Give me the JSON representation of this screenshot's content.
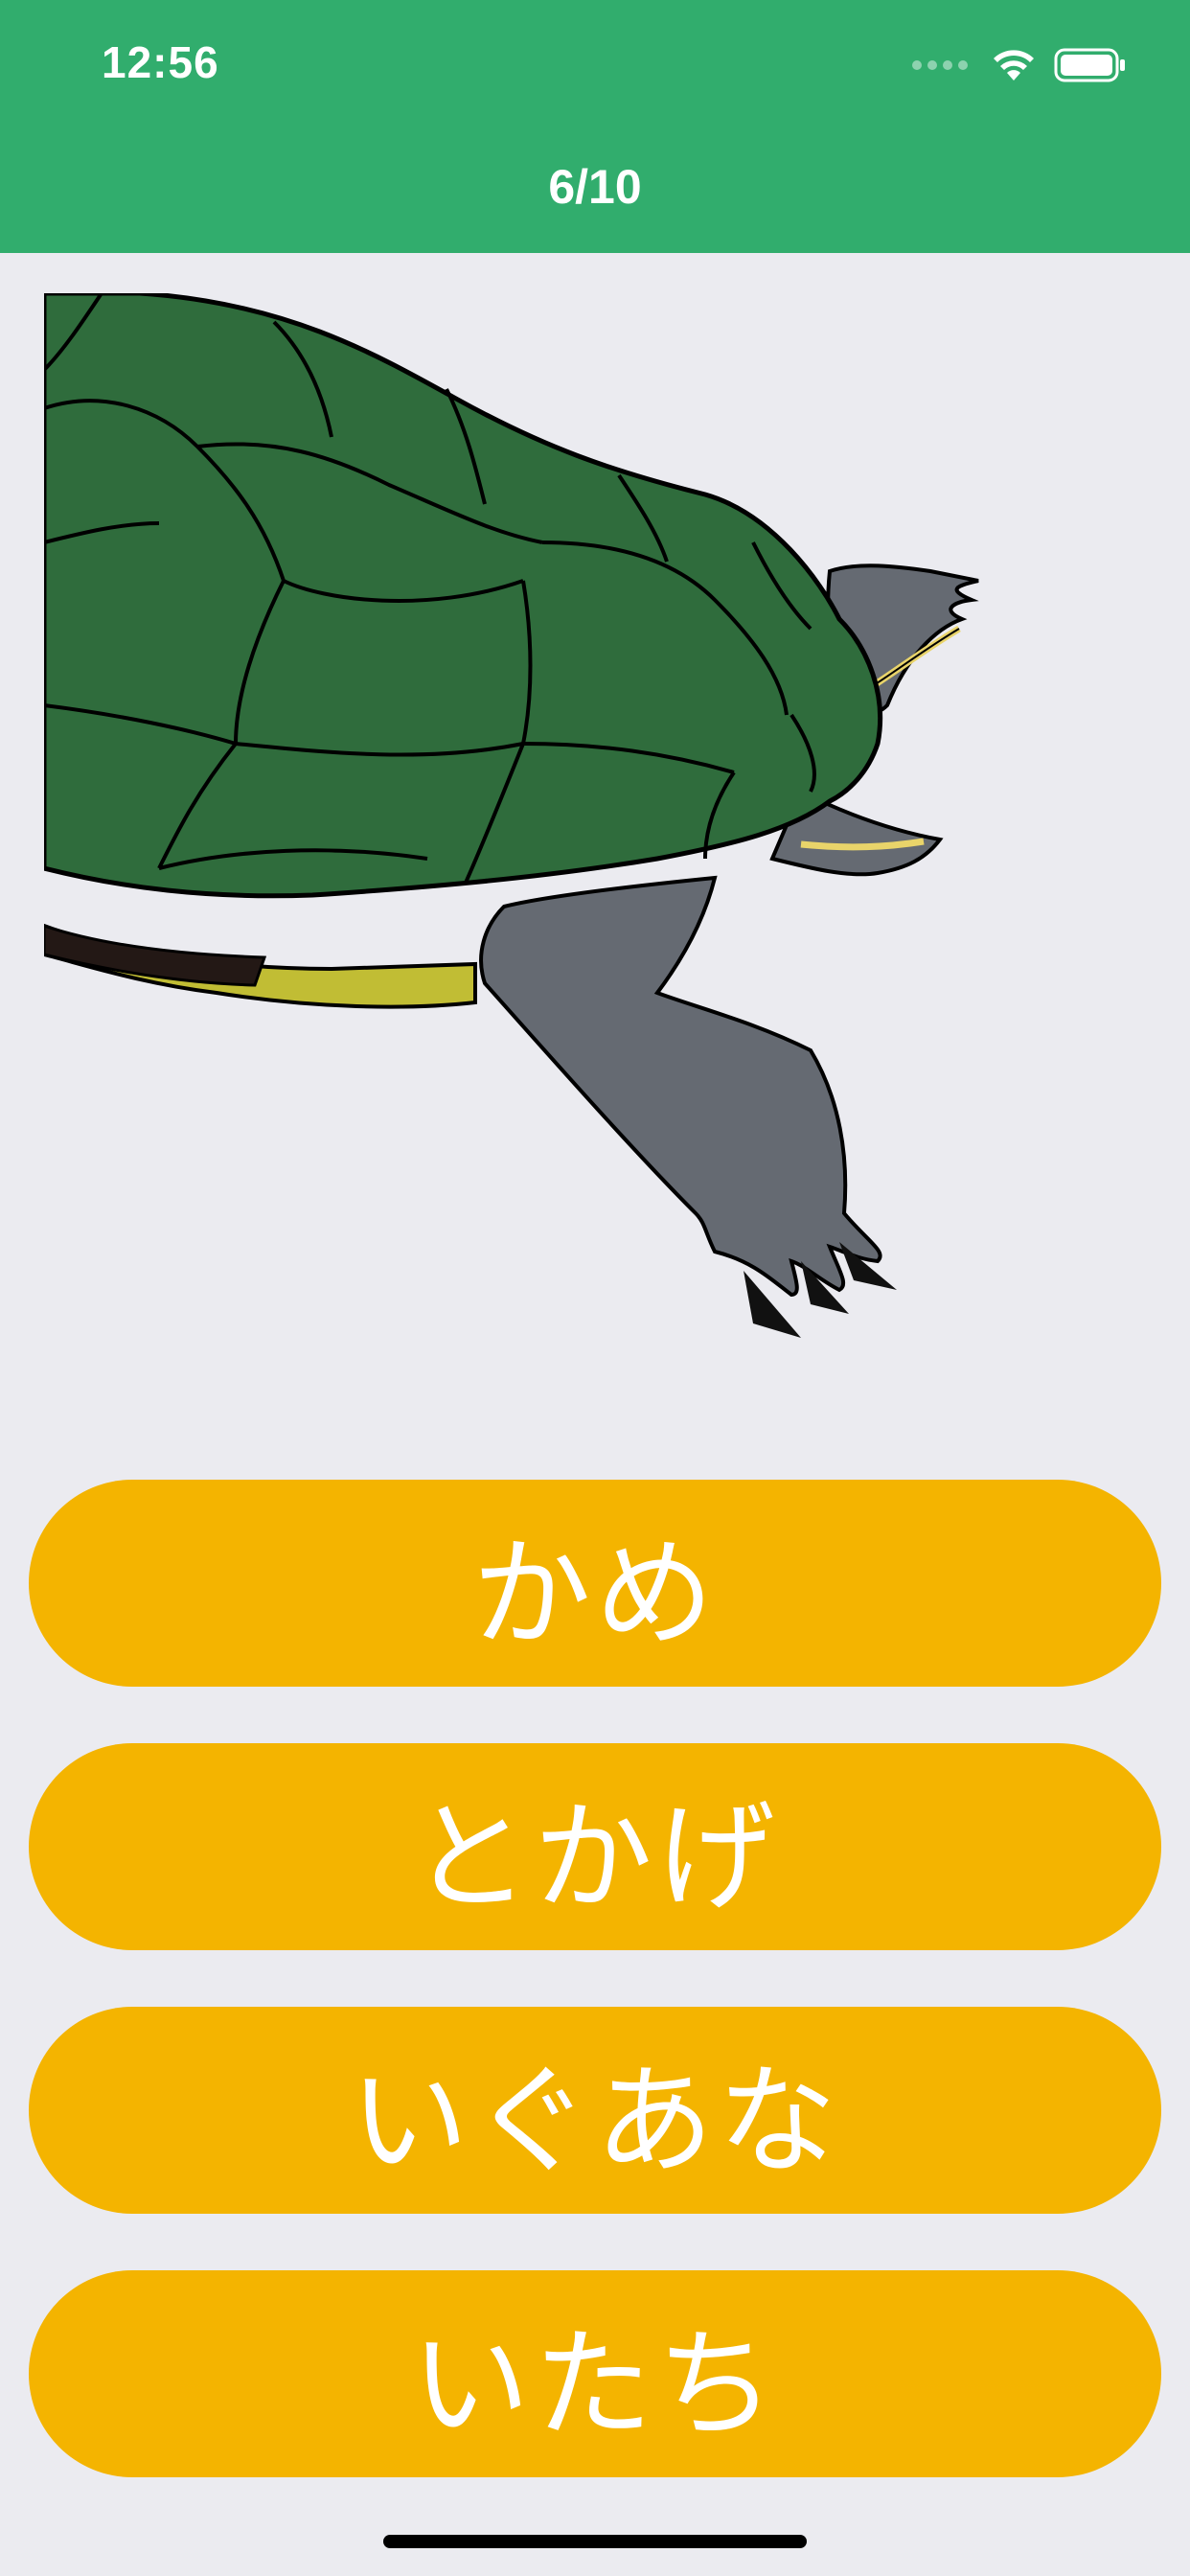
{
  "status_bar": {
    "time": "12:56"
  },
  "header": {
    "progress": "6/10",
    "background_color": "#31AD6D"
  },
  "illustration": {
    "subject": "turtle"
  },
  "answers": [
    {
      "label": "かめ"
    },
    {
      "label": "とかげ"
    },
    {
      "label": "いぐあな"
    },
    {
      "label": "いたち"
    }
  ],
  "colors": {
    "answer_button": "#F4B400",
    "background": "#EBEBF0"
  }
}
